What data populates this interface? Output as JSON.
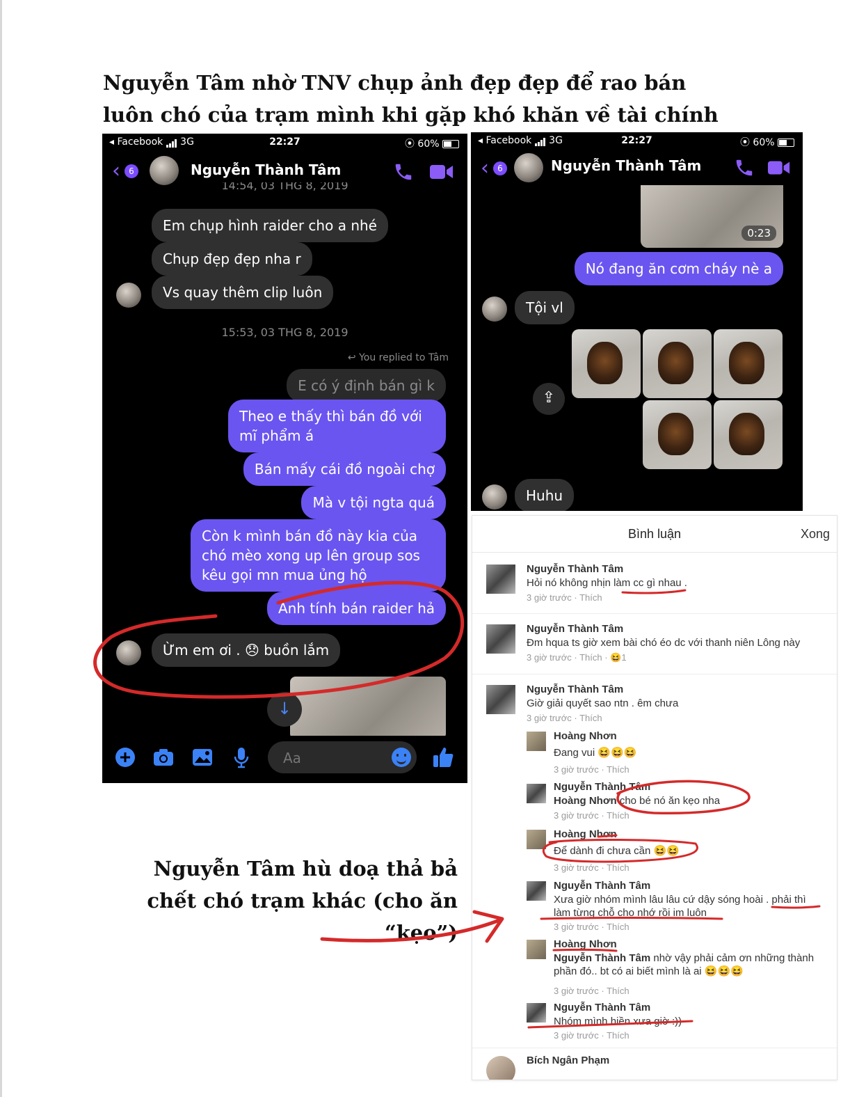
{
  "headings": {
    "top": "Nguyễn Tâm nhờ TNV chụp ảnh đẹp đẹp để rao bán luôn chó của trạm mình khi gặp khó khăn về tài chính",
    "bottom": "Nguyễn Tâm hù doạ thả bả chết chó trạm khác (cho ăn “kẹo”)"
  },
  "left_chat": {
    "status": {
      "carrier": "◂ Facebook",
      "network": "3G",
      "time": "22:27",
      "battery": "60%"
    },
    "unread_count": "6",
    "contact_name": "Nguyễn Thành Tâm",
    "cut_timestamp": "14:54, 03 THG 8, 2019",
    "messages_in": [
      "Em chụp hình raider cho a nhé",
      "Chụp đẹp đẹp nha r",
      "Vs quay thêm clip luôn"
    ],
    "timestamp": "15:53, 03 THG 8, 2019",
    "reply_note": "You replied to Tâm",
    "quoted": "E có ý định bán gì k",
    "messages_out": [
      "Theo e thấy thì bán đồ với mĩ phẩm á",
      "Bán mấy cái đồ ngoài chợ",
      "Mà v tội ngta quá",
      "Còn k mình bán đồ này kia của chó mèo xong up lên group sos kêu gọi mn mua ủng hộ",
      "Anh tính bán raider hả"
    ],
    "last_in": "Ừm em ơi . 😞 buồn lắm",
    "compose_placeholder": "Aa",
    "icons": [
      "add-icon",
      "camera-icon",
      "gallery-icon",
      "microphone-icon",
      "emoji-icon",
      "thumbs-up-icon"
    ]
  },
  "right_chat": {
    "status": {
      "carrier": "◂ Facebook",
      "network": "3G",
      "time": "22:27",
      "battery": "60%"
    },
    "unread_count": "6",
    "contact_name": "Nguyễn Thành Tâm",
    "video_duration": "0:23",
    "message_out": "Nó đang ăn cơm cháy nè a",
    "message_in_1": "Tội vl",
    "message_in_2": "Huhu",
    "photo_count": 5
  },
  "comments": {
    "title": "Bình luận",
    "done": "Xong",
    "like": "Thích",
    "items": [
      {
        "name": "Nguyễn Thành Tâm",
        "text": "Hỏi nó không nhịn làm cc gì nhau .",
        "meta": "3 giờ trước · Thích"
      },
      {
        "name": "Nguyễn Thành Tâm",
        "text": "Đm hqua ts giờ xem bài chó éo dc với thanh niên Lông này",
        "meta": "3 giờ trước · Thích · 😆1"
      },
      {
        "name": "Nguyễn Thành Tâm",
        "text": "Giờ giải quyết sao ntn . êm chưa",
        "meta": "3 giờ trước · Thích"
      }
    ],
    "replies": [
      {
        "name": "Hoàng Nhơn",
        "text": "Đang vui 😆😆😆",
        "meta": "3 giờ trước · Thích"
      },
      {
        "name": "Nguyễn Thành Tâm",
        "tag": "Hoàng Nhơn",
        "text": "cho bé nó ăn kẹo nha",
        "meta": "3 giờ trước · Thích"
      },
      {
        "name": "Hoàng Nhơn",
        "text": "Để dành đi chưa cần 😆😆",
        "meta": "3 giờ trước · Thích"
      },
      {
        "name": "Nguyễn Thành Tâm",
        "text": "Xưa giờ nhóm mình lâu lâu cứ dậy sóng hoài . phải thì làm từng chỗ cho nhớ rồi im luôn",
        "meta": "3 giờ trước · Thích"
      },
      {
        "name": "Hoàng Nhơn",
        "tag": "Nguyễn Thành Tâm",
        "text": "nhờ vậy phải cảm ơn những thành phần đó.. bt có ai biết mình là ai 😆😆😆",
        "meta": "3 giờ trước · Thích"
      },
      {
        "name": "Nguyễn Thành Tâm",
        "text": "Nhóm mình hiền xưa giờ :))",
        "meta": "3 giờ trước · Thích"
      }
    ],
    "last_name": "Bích Ngân Phạm"
  },
  "colors": {
    "outgoing_bubble": "#6a55f0",
    "incoming_bubble": "#303030",
    "messenger_accent": "#7c4dff",
    "annotation_red": "#d42a2a"
  }
}
